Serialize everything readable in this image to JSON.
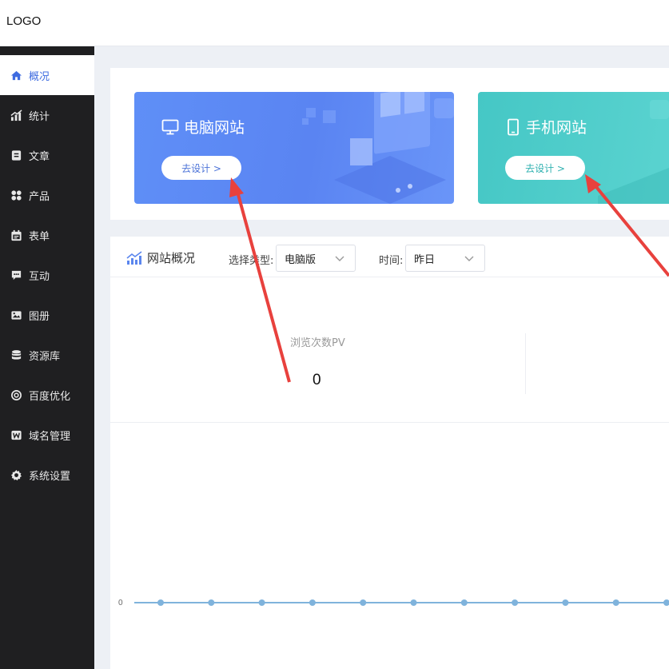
{
  "header": {
    "logo": "LOGO"
  },
  "sidebar": {
    "items": [
      {
        "label": "概况",
        "icon": "home-icon",
        "active": true
      },
      {
        "label": "统计",
        "icon": "stats-icon",
        "active": false
      },
      {
        "label": "文章",
        "icon": "article-icon",
        "active": false
      },
      {
        "label": "产品",
        "icon": "grid-icon",
        "active": false
      },
      {
        "label": "表单",
        "icon": "calendar-icon",
        "active": false
      },
      {
        "label": "互动",
        "icon": "chat-icon",
        "active": false
      },
      {
        "label": "图册",
        "icon": "image-icon",
        "active": false
      },
      {
        "label": "资源库",
        "icon": "database-icon",
        "active": false
      },
      {
        "label": "百度优化",
        "icon": "target-icon",
        "active": false
      },
      {
        "label": "域名管理",
        "icon": "domain-icon",
        "active": false
      },
      {
        "label": "系统设置",
        "icon": "gear-icon",
        "active": false
      }
    ]
  },
  "cards": {
    "pc": {
      "title": "电脑网站",
      "button": "去设计 >",
      "icon": "monitor-icon"
    },
    "mobile": {
      "title": "手机网站",
      "button": "去设计 >",
      "icon": "phone-icon"
    }
  },
  "overview": {
    "title": "网站概况",
    "type_label": "选择类型:",
    "type_value": "电脑版",
    "time_label": "时间:",
    "time_value": "昨日",
    "stats": [
      {
        "label": "浏览次数PV",
        "value": "0"
      }
    ]
  },
  "chart_data": {
    "type": "line",
    "y_tick_labels": [
      "0"
    ],
    "series": [
      {
        "values": [
          0,
          0,
          0,
          0,
          0,
          0,
          0,
          0,
          0,
          0,
          0
        ]
      }
    ],
    "color": "#7fb3dc"
  },
  "colors": {
    "accent": "#3f6ce0",
    "sidebar_bg": "#1f1f21",
    "arrow": "#e8413d"
  }
}
